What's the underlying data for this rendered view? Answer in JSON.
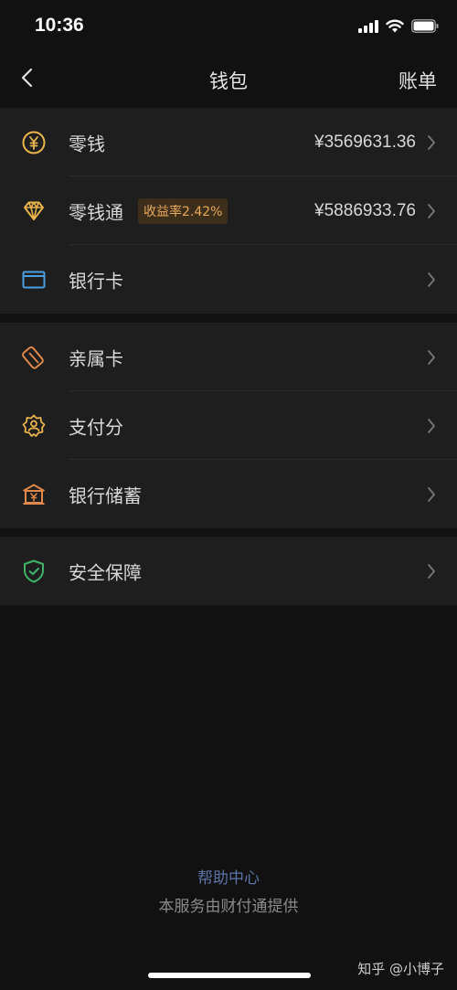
{
  "status_bar": {
    "time": "10:36"
  },
  "nav": {
    "title": "钱包",
    "right_label": "账单"
  },
  "sections": [
    {
      "items": [
        {
          "id": "change",
          "icon": "yen-coin-icon",
          "label": "零钱",
          "value": "¥3569631.36"
        },
        {
          "id": "lingqiantong",
          "icon": "diamond-icon",
          "label": "零钱通",
          "badge": "收益率2.42%",
          "value": "¥5886933.76"
        },
        {
          "id": "bank-card",
          "icon": "bank-card-icon",
          "label": "银行卡"
        }
      ]
    },
    {
      "items": [
        {
          "id": "family-card",
          "icon": "family-card-icon",
          "label": "亲属卡"
        },
        {
          "id": "pay-score",
          "icon": "pay-score-icon",
          "label": "支付分"
        },
        {
          "id": "bank-savings",
          "icon": "bank-building-icon",
          "label": "银行储蓄"
        }
      ]
    },
    {
      "items": [
        {
          "id": "security",
          "icon": "shield-check-icon",
          "label": "安全保障"
        }
      ]
    }
  ],
  "footer": {
    "help_link": "帮助中心",
    "provider_text": "本服务由财付通提供"
  },
  "watermark": "知乎 @小博子",
  "colors": {
    "background": "#111111",
    "section_bg": "#1e1e1e",
    "gold_icon": "#e9b44c",
    "orange_icon": "#e0894a",
    "blue_icon": "#4a9fe0",
    "green_icon": "#3fb36a",
    "link": "#5c73a6"
  }
}
